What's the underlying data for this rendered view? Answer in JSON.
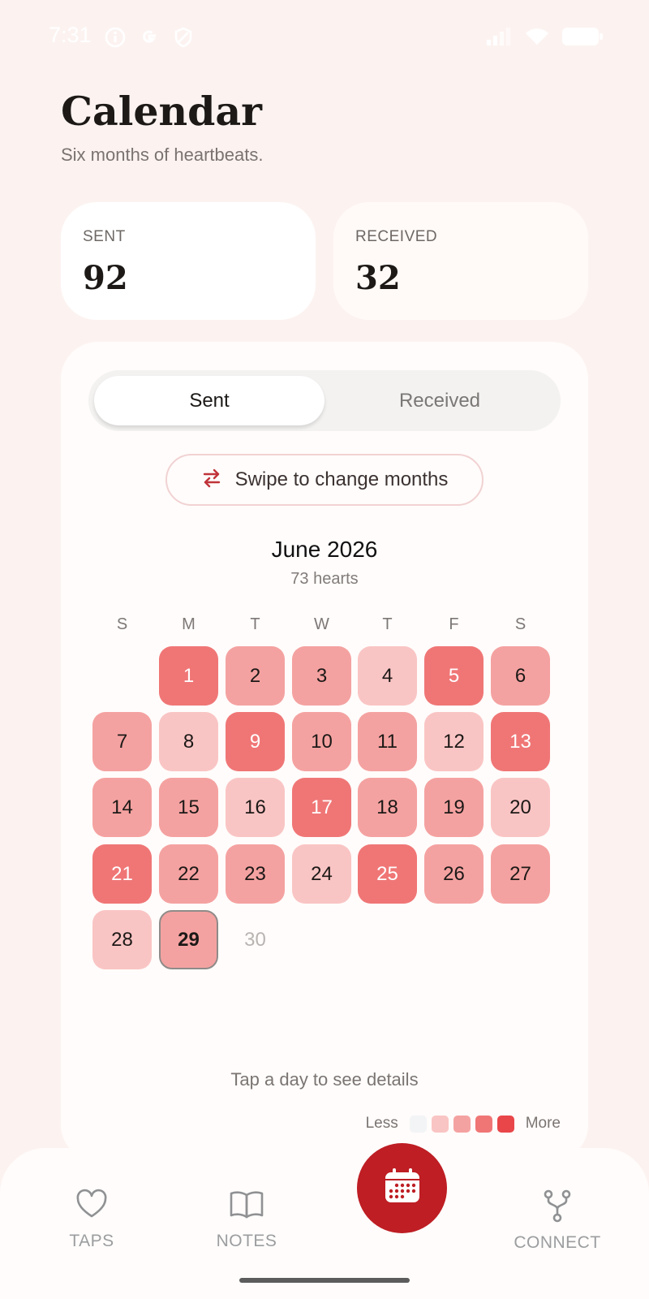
{
  "status_bar": {
    "time": "7:31",
    "left_icons": [
      "info-icon",
      "google-icon",
      "shield-icon"
    ],
    "right_icons": [
      "signal-icon",
      "wifi-icon",
      "battery-icon"
    ]
  },
  "header": {
    "title": "Calendar",
    "subtitle": "Six months of heartbeats."
  },
  "stats": {
    "sent_label": "SENT",
    "sent_value": "92",
    "received_label": "RECEIVED",
    "received_value": "32"
  },
  "toggle": {
    "options": [
      "Sent",
      "Received"
    ],
    "selected": "Sent"
  },
  "swipe_hint": {
    "icon": "swap-arrows-icon",
    "label": "Swipe to change months"
  },
  "month": {
    "title": "June 2026",
    "count_label": "73 hearts"
  },
  "weekdays": [
    "S",
    "M",
    "T",
    "W",
    "T",
    "F",
    "S"
  ],
  "days": [
    {
      "day": "1",
      "level": 3
    },
    {
      "day": "2",
      "level": 2
    },
    {
      "day": "3",
      "level": 2
    },
    {
      "day": "4",
      "level": 1
    },
    {
      "day": "5",
      "level": 3
    },
    {
      "day": "6",
      "level": 2
    },
    {
      "day": "7",
      "level": 2
    },
    {
      "day": "8",
      "level": 1
    },
    {
      "day": "9",
      "level": 3
    },
    {
      "day": "10",
      "level": 2
    },
    {
      "day": "11",
      "level": 2
    },
    {
      "day": "12",
      "level": 1
    },
    {
      "day": "13",
      "level": 3
    },
    {
      "day": "14",
      "level": 2
    },
    {
      "day": "15",
      "level": 2
    },
    {
      "day": "16",
      "level": 1
    },
    {
      "day": "17",
      "level": 3
    },
    {
      "day": "18",
      "level": 2
    },
    {
      "day": "19",
      "level": 2
    },
    {
      "day": "20",
      "level": 1
    },
    {
      "day": "21",
      "level": 3
    },
    {
      "day": "22",
      "level": 2
    },
    {
      "day": "23",
      "level": 2
    },
    {
      "day": "24",
      "level": 1
    },
    {
      "day": "25",
      "level": 3
    },
    {
      "day": "26",
      "level": 2
    },
    {
      "day": "27",
      "level": 2
    },
    {
      "day": "28",
      "level": 1
    },
    {
      "day": "29",
      "level": 2,
      "today": true
    },
    {
      "day": "30",
      "level": 0
    }
  ],
  "footer_hint": "Tap a day to see details",
  "legend": {
    "less_label": "Less",
    "more_label": "More",
    "colors": [
      "#f3f4f6",
      "#f9c5c4",
      "#f4a2a1",
      "#f07676",
      "#e9464a"
    ]
  },
  "nav": {
    "items": [
      {
        "label": "TAPS",
        "icon": "heart-icon"
      },
      {
        "label": "NOTES",
        "icon": "book-icon"
      },
      {
        "label": "",
        "icon": "calendar-icon",
        "active": true
      },
      {
        "label": "CONNECT",
        "icon": "connect-fork-icon"
      }
    ]
  },
  "colors": {
    "accent": "#be1e24",
    "background": "#fcf3f1"
  }
}
